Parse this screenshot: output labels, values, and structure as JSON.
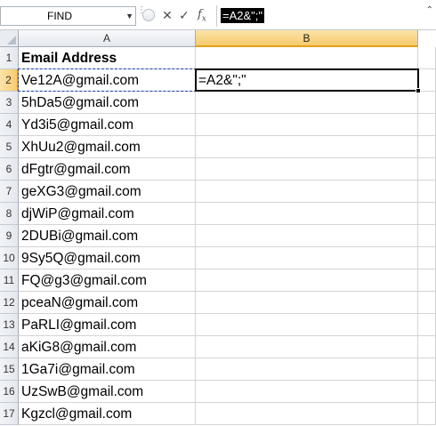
{
  "formula_bar": {
    "name_box": "FIND",
    "cancel_icon": "close-icon",
    "enter_icon": "checkmark-icon",
    "function_icon": "fx-icon",
    "formula": "=A2&\";\""
  },
  "columns": [
    "A",
    "B"
  ],
  "rows": [
    {
      "num": "1",
      "a": "Email Address",
      "b": ""
    },
    {
      "num": "2",
      "a": "Ve12A@gmail.com",
      "b": "=A2&\";\""
    },
    {
      "num": "3",
      "a": "5hDa5@gmail.com",
      "b": ""
    },
    {
      "num": "4",
      "a": "Yd3i5@gmail.com",
      "b": ""
    },
    {
      "num": "5",
      "a": "XhUu2@gmail.com",
      "b": ""
    },
    {
      "num": "6",
      "a": "dFgtr@gmail.com",
      "b": ""
    },
    {
      "num": "7",
      "a": "geXG3@gmail.com",
      "b": ""
    },
    {
      "num": "8",
      "a": "djWiP@gmail.com",
      "b": ""
    },
    {
      "num": "9",
      "a": "2DUBi@gmail.com",
      "b": ""
    },
    {
      "num": "10",
      "a": "9Sy5Q@gmail.com",
      "b": ""
    },
    {
      "num": "11",
      "a": "FQ@g3@gmail.com",
      "b": ""
    },
    {
      "num": "12",
      "a": "pceaN@gmail.com",
      "b": ""
    },
    {
      "num": "13",
      "a": "PaRLI@gmail.com",
      "b": ""
    },
    {
      "num": "14",
      "a": "aKiG8@gmail.com",
      "b": ""
    },
    {
      "num": "15",
      "a": "1Ga7i@gmail.com",
      "b": ""
    },
    {
      "num": "16",
      "a": "UzSwB@gmail.com",
      "b": ""
    },
    {
      "num": "17",
      "a": "Kgzcl@gmail.com",
      "b": ""
    }
  ],
  "active_cell": "B2",
  "colors": {
    "active_header": "#f6cb6d",
    "reference_border": "#1d3fa8"
  }
}
